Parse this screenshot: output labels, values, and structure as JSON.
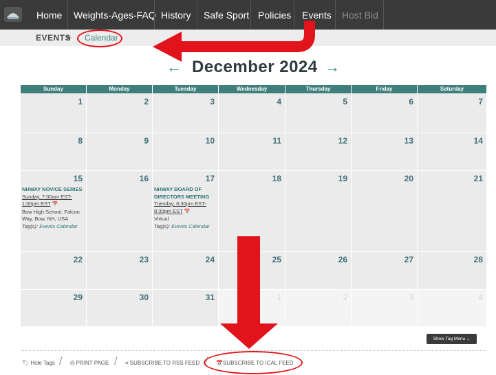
{
  "nav": {
    "logo_text": "",
    "items": [
      {
        "label": "Home"
      },
      {
        "label": "Weights-Ages-FAQ"
      },
      {
        "label": "History"
      },
      {
        "label": "Safe Sport"
      },
      {
        "label": "Policies"
      },
      {
        "label": "Events"
      },
      {
        "label": "Host Bid"
      }
    ]
  },
  "breadcrumb": {
    "events": "EVENTS",
    "separator": ">",
    "calendar": "Calendar"
  },
  "calendar": {
    "title": "December 2024",
    "prev": "←",
    "next": "→",
    "weekdays": [
      "Sunday",
      "Monday",
      "Tuesday",
      "Wednesday",
      "Thursday",
      "Friday",
      "Saturday"
    ],
    "weeks": [
      [
        "1",
        "2",
        "3",
        "4",
        "5",
        "6",
        "7"
      ],
      [
        "8",
        "9",
        "10",
        "11",
        "12",
        "13",
        "14"
      ],
      [
        "15",
        "16",
        "17",
        "18",
        "19",
        "20",
        "21"
      ],
      [
        "22",
        "23",
        "24",
        "25",
        "26",
        "27",
        "28"
      ],
      [
        "29",
        "30",
        "31",
        "1",
        "2",
        "3",
        "4"
      ]
    ],
    "events": {
      "novice": {
        "title": "NHWAY NOVICE SERIES",
        "time": "Sunday, 7:00am EST-1:00pm EST",
        "location": "Bow High School, Falcon Way, Bow, NH, USA",
        "tags_label": "Tag(s):",
        "tags": "Events Calendar"
      },
      "board": {
        "title": "NHWAY BOARD OF DIRECTORS MEETING",
        "time": "Tuesday, 6:30pm EST-8:30pm EST",
        "location": "Virtual",
        "tags_label": "Tag(s):",
        "tags": "Events Calendar"
      }
    }
  },
  "footer": {
    "show_tag_menu": "Show Tag Menu",
    "hide_tags": "Hide Tags",
    "print_page": "PRINT PAGE",
    "rss": "SUBSCRIBE TO RSS FEED",
    "ical": "SUBSCRIBE TO ICAL FEED"
  },
  "colors": {
    "accent": "#3c8480",
    "header": "#3f7f7b",
    "annotation": "#e2141b"
  }
}
